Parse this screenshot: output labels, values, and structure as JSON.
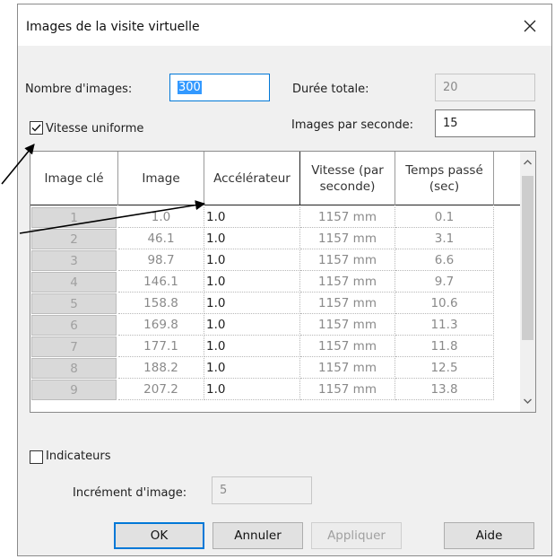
{
  "dialog": {
    "title": "Images de la visite virtuelle",
    "close_label": "×"
  },
  "fields": {
    "nombre_images_label": "Nombre d'images:",
    "nombre_images_value": "300",
    "duree_totale_label": "Durée totale:",
    "duree_totale_value": "20",
    "images_par_seconde_label": "Images par seconde:",
    "images_par_seconde_value": "15",
    "vitesse_uniforme_label": "Vitesse uniforme",
    "vitesse_uniforme_checked": true,
    "indicateurs_label": "Indicateurs",
    "indicateurs_checked": false,
    "increment_label": "Incrément d'image:",
    "increment_value": "5"
  },
  "table": {
    "columns": [
      "Image clé",
      "Image",
      "Accélérateur",
      "Vitesse (par\nseconde)",
      "Temps passé\n(sec)"
    ],
    "rows": [
      [
        "1",
        "1.0",
        "1.0",
        "1157 mm",
        "0.1"
      ],
      [
        "2",
        "46.1",
        "1.0",
        "1157 mm",
        "3.1"
      ],
      [
        "3",
        "98.7",
        "1.0",
        "1157 mm",
        "6.6"
      ],
      [
        "4",
        "146.1",
        "1.0",
        "1157 mm",
        "9.7"
      ],
      [
        "5",
        "158.8",
        "1.0",
        "1157 mm",
        "10.6"
      ],
      [
        "6",
        "169.8",
        "1.0",
        "1157 mm",
        "11.3"
      ],
      [
        "7",
        "177.1",
        "1.0",
        "1157 mm",
        "11.8"
      ],
      [
        "8",
        "188.2",
        "1.0",
        "1157 mm",
        "12.5"
      ],
      [
        "9",
        "207.2",
        "1.0",
        "1157 mm",
        "13.8"
      ]
    ]
  },
  "buttons": {
    "ok": "OK",
    "annuler": "Annuler",
    "appliquer": "Appliquer",
    "aide": "Aide"
  },
  "colors": {
    "accent": "#0078d7",
    "selection": "#3399ff",
    "window_bg": "#f0f0f0"
  }
}
